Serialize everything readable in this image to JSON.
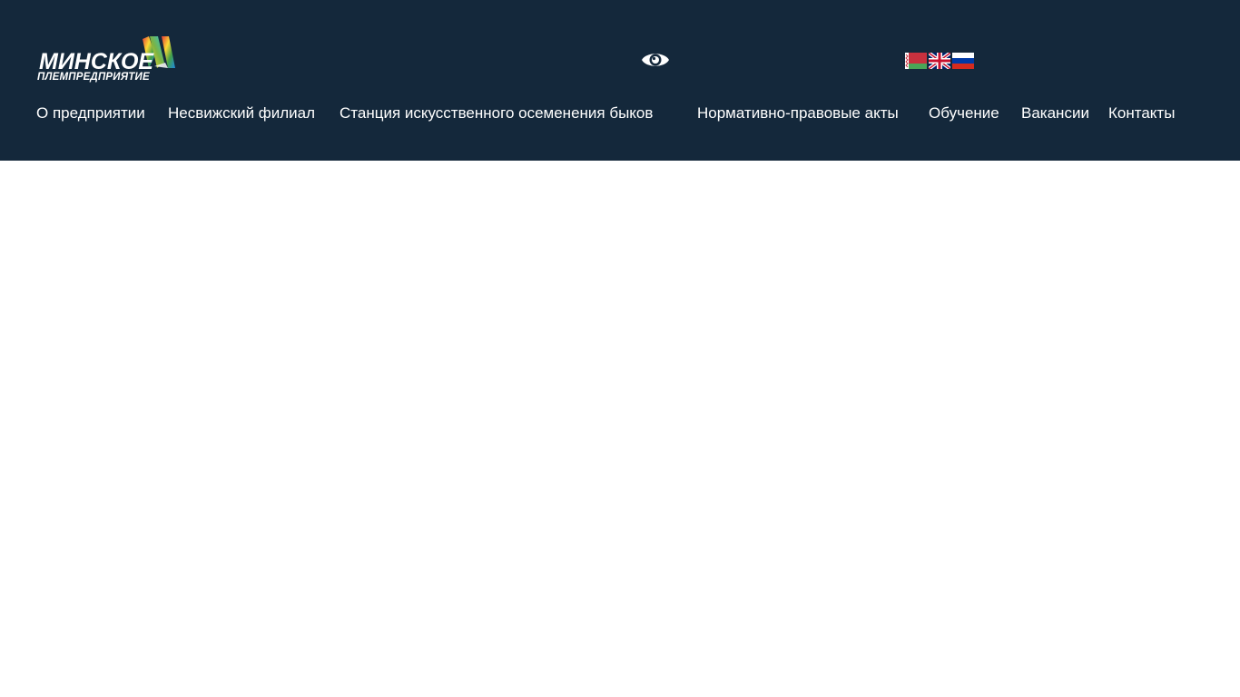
{
  "logo": {
    "title": "МИНСКОЕ",
    "subtitle": "ПЛЕМПРЕДПРИЯТИЕ"
  },
  "header": {
    "background": "#14283b",
    "accessibility_icon": "eye-icon"
  },
  "languages": [
    {
      "code": "be",
      "icon": "belarus-flag-icon"
    },
    {
      "code": "en",
      "icon": "uk-flag-icon"
    },
    {
      "code": "ru",
      "icon": "russia-flag-icon"
    }
  ],
  "nav": {
    "items": [
      {
        "label": "О предприятии"
      },
      {
        "label": "Несвижский филиал"
      },
      {
        "label": "Станция искусственного осеменения быков"
      },
      {
        "label": "Нормативно-правовые акты"
      },
      {
        "label": "Обучение"
      },
      {
        "label": "Вакансии"
      },
      {
        "label": "Контакты"
      }
    ]
  }
}
